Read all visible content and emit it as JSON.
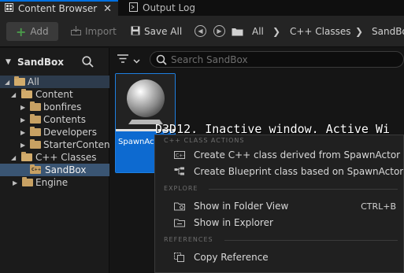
{
  "tabs": [
    {
      "label": "Content Browser",
      "icon": "content-browser-icon",
      "close": "✕"
    },
    {
      "label": "Output Log",
      "icon": "output-log-icon"
    }
  ],
  "toolbar": {
    "add_label": "Add",
    "import_label": "Import",
    "saveall_label": "Save All"
  },
  "breadcrumb": [
    "All",
    "C++ Classes",
    "SandBox"
  ],
  "sidebar": {
    "title": "SandBox",
    "tree": [
      {
        "label": "All",
        "level": 0,
        "expanded": true,
        "type": "folder"
      },
      {
        "label": "Content",
        "level": 1,
        "expanded": true,
        "type": "folder"
      },
      {
        "label": "bonfires",
        "level": 2,
        "type": "folder"
      },
      {
        "label": "Contents",
        "level": 2,
        "type": "folder"
      },
      {
        "label": "Developers",
        "level": 2,
        "type": "folder"
      },
      {
        "label": "StarterContent",
        "level": 2,
        "type": "folder"
      },
      {
        "label": "C++ Classes",
        "level": 1,
        "expanded": true,
        "type": "folder"
      },
      {
        "label": "SandBox",
        "level": 2,
        "type": "cpp-folder",
        "selected": true
      },
      {
        "label": "Engine",
        "level": 1,
        "type": "folder"
      }
    ]
  },
  "search": {
    "placeholder": "Search SandBox"
  },
  "asset": {
    "name": "SpawnActor"
  },
  "overlay_text": "D3D12. Inactive window. Active Wi",
  "context_menu": {
    "sections": [
      {
        "header": "C++ CLASS ACTIONS",
        "items": [
          {
            "label": "Create C++ class derived from SpawnActor",
            "icon": "cpp-class-icon"
          },
          {
            "label": "Create Blueprint class based on SpawnActor",
            "icon": "blueprint-class-icon"
          }
        ]
      },
      {
        "header": "EXPLORE",
        "items": [
          {
            "label": "Show in Folder View",
            "icon": "folder-view-icon",
            "shortcut": "CTRL+B"
          },
          {
            "label": "Show in Explorer",
            "icon": "explorer-icon"
          }
        ]
      },
      {
        "header": "REFERENCES",
        "items": [
          {
            "label": "Copy Reference",
            "icon": "copy-reference-icon"
          }
        ]
      }
    ]
  },
  "colors": {
    "accent": "#0070e0",
    "selection": "#3a5573",
    "asset_name_bg": "#0d6ad0",
    "folder": "#c8a163"
  }
}
